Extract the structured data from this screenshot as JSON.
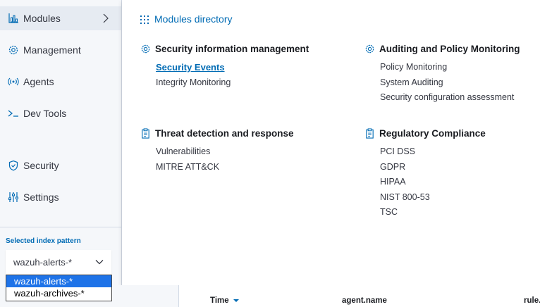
{
  "sidebar": {
    "items": [
      {
        "label": "Modules",
        "icon": "chart-icon"
      },
      {
        "label": "Management",
        "icon": "gear-icon"
      },
      {
        "label": "Agents",
        "icon": "broadcast-icon"
      },
      {
        "label": "Dev Tools",
        "icon": "console-icon"
      },
      {
        "label": "Security",
        "icon": "shield-icon"
      },
      {
        "label": "Settings",
        "icon": "sliders-icon"
      }
    ],
    "index_pattern_label": "Selected index pattern",
    "index_pattern_value": "wazuh-alerts-*",
    "index_pattern_options": [
      "wazuh-alerts-*",
      "wazuh-archives-*"
    ]
  },
  "main": {
    "title": "Modules directory",
    "sections": [
      {
        "heading": "Security information management",
        "icon": "gear-icon",
        "items": [
          "Security Events",
          "Integrity Monitoring"
        ]
      },
      {
        "heading": "Auditing and Policy Monitoring",
        "icon": "gear-icon",
        "items": [
          "Policy Monitoring",
          "System Auditing",
          "Security configuration assessment"
        ]
      },
      {
        "heading": "Threat detection and response",
        "icon": "clipboard-icon",
        "items": [
          "Vulnerabilities",
          "MITRE ATT&CK"
        ]
      },
      {
        "heading": "Regulatory Compliance",
        "icon": "clipboard-icon",
        "items": [
          "PCI DSS",
          "GDPR",
          "HIPAA",
          "NIST 800-53",
          "TSC"
        ]
      }
    ]
  },
  "table": {
    "columns": [
      "Time",
      "agent.name",
      "rule."
    ]
  },
  "colors": {
    "accent": "#006bb4",
    "selected_option": "#1e73e8",
    "sidebar_bg": "#f5f7fa"
  }
}
